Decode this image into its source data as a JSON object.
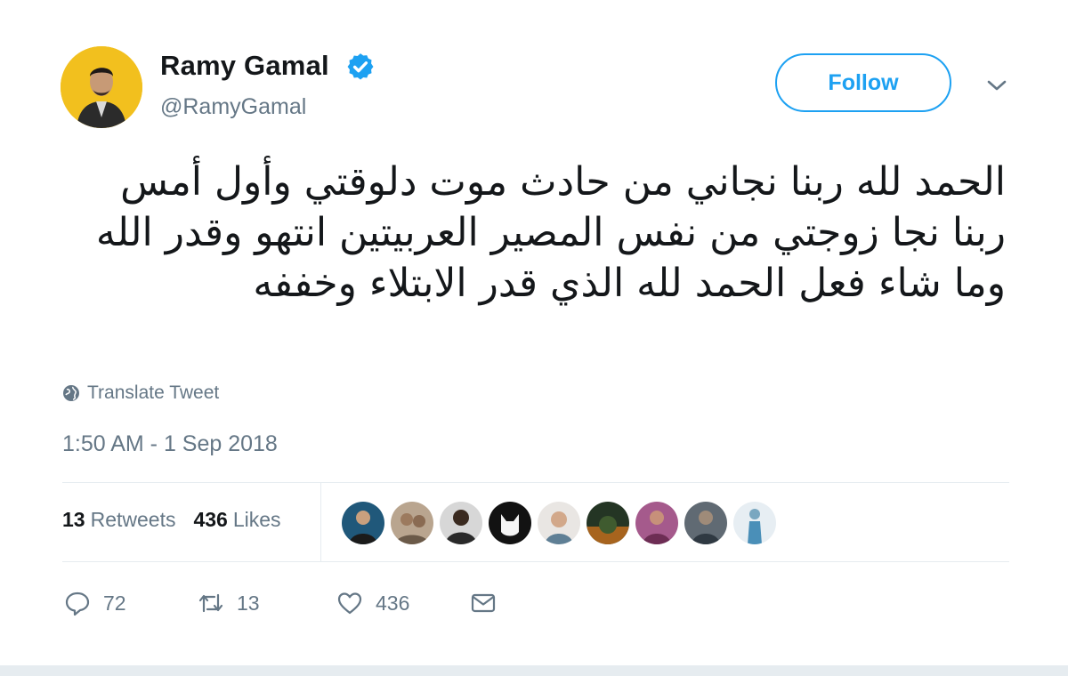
{
  "author": {
    "name": "Ramy Gamal",
    "handle": "@RamyGamal",
    "verified": true
  },
  "follow_label": "Follow",
  "tweet_text": "الحمد لله ربنا نجاني من حادث موت دلوقتي وأول أمس ربنا نجا زوجتي من نفس المصير العربيتين انتهو وقدر الله وما شاء فعل الحمد لله الذي قدر الابتلاء وخففه",
  "translate_label": "Translate Tweet",
  "timestamp": "1:50 AM - 1 Sep 2018",
  "stats": {
    "retweets_count": "13",
    "retweets_label": "Retweets",
    "likes_count": "436",
    "likes_label": "Likes"
  },
  "actions": {
    "reply_count": "72",
    "retweet_count": "13",
    "like_count": "436"
  },
  "icons": {
    "verified": "verified-badge-icon",
    "caret": "chevron-down-icon",
    "translate": "globe-icon",
    "reply": "reply-icon",
    "retweet": "retweet-icon",
    "like": "heart-icon",
    "dm": "envelope-icon"
  },
  "colors": {
    "accent": "#1da1f2",
    "muted": "#657786",
    "text": "#14171a",
    "divider": "#e6ecf0"
  }
}
